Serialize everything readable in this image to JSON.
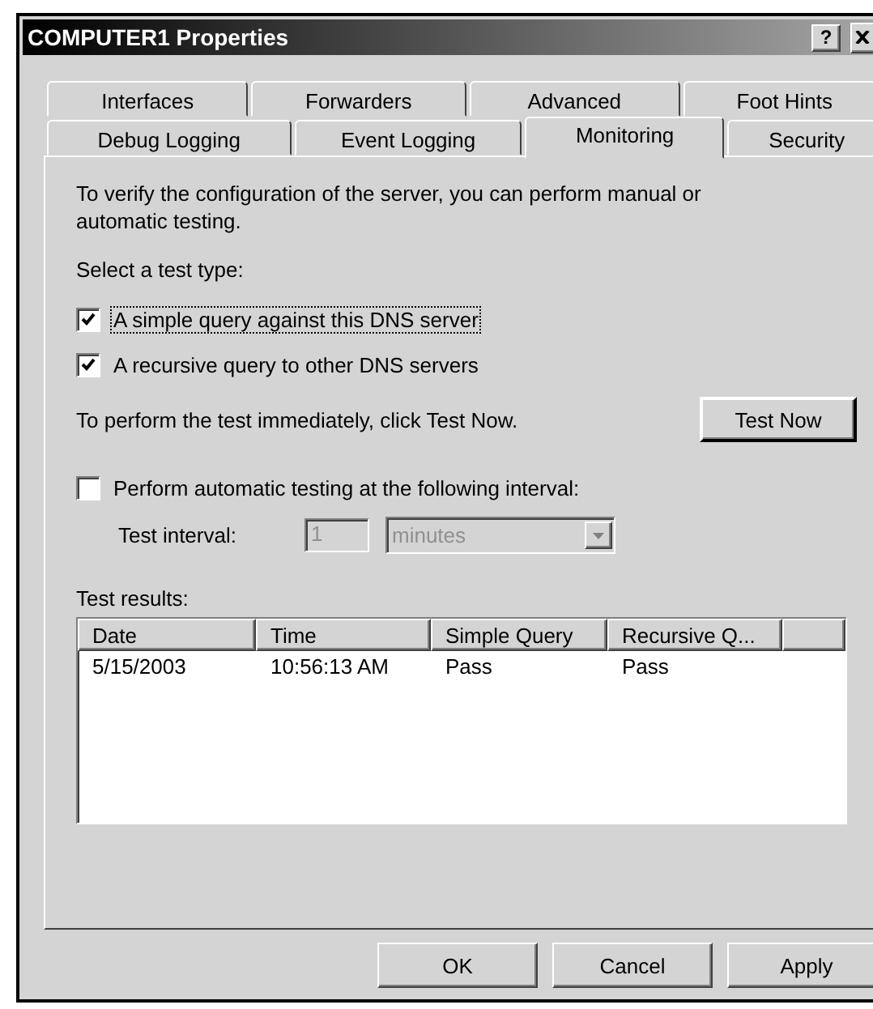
{
  "window": {
    "title": "COMPUTER1 Properties",
    "title_buttons": [
      "?"
    ]
  },
  "tab_rows": [
    [
      {
        "label": "Interfaces",
        "selected": false
      },
      {
        "label": "Forwarders",
        "selected": false
      },
      {
        "label": "Advanced",
        "selected": false
      },
      {
        "label": "Foot Hints",
        "selected": false
      }
    ],
    [
      {
        "label": "Debug Logging",
        "selected": false
      },
      {
        "label": "Event Logging",
        "selected": false
      },
      {
        "label": "Monitoring",
        "selected": true
      },
      {
        "label": "Security",
        "selected": false
      }
    ]
  ],
  "intro": "To verify the configuration of the server, you can perform manual or automatic testing.",
  "test_type_label": "Select a test type:",
  "test_types": [
    {
      "label": "A simple query against this DNS server",
      "checked": true,
      "focused": true
    },
    {
      "label": "A recursive query to other DNS servers",
      "checked": true,
      "focused": false
    }
  ],
  "test_now": {
    "text": "To perform the test immediately, click Test Now.",
    "button": "Test Now"
  },
  "auto_test": {
    "label": "Perform automatic testing at the following interval:",
    "checked": false
  },
  "interval": {
    "label": "Test interval:",
    "value": "1",
    "unit": "minutes",
    "disabled": true
  },
  "results": {
    "label": "Test results:",
    "columns": [
      "Date",
      "Time",
      "Simple Query",
      "Recursive Q..."
    ],
    "rows": [
      [
        "5/15/2003",
        "10:56:13 AM",
        "Pass",
        "Pass"
      ]
    ]
  },
  "buttons": [
    {
      "label": "OK"
    },
    {
      "label": "Cancel"
    },
    {
      "label": "Apply"
    }
  ]
}
